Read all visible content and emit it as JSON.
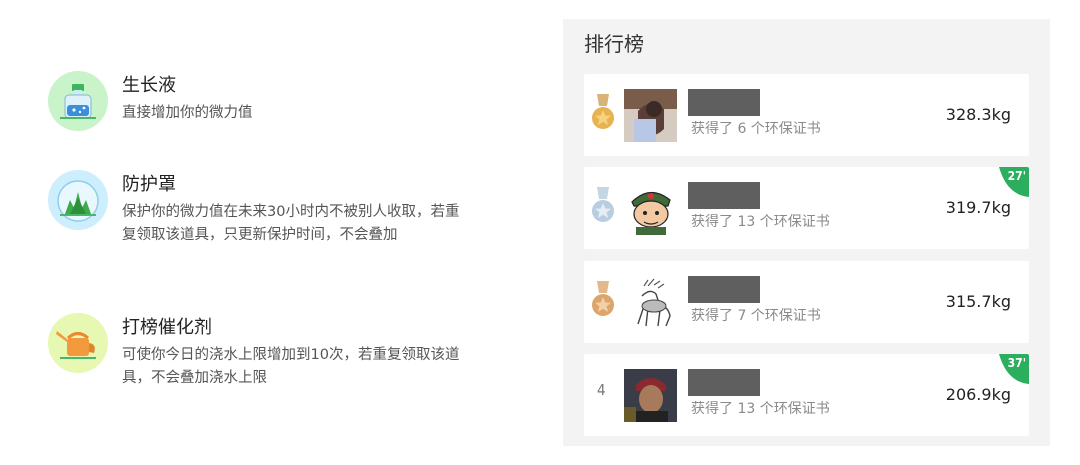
{
  "items": [
    {
      "title": "生长液",
      "desc": "直接增加你的微力值",
      "icon": "growth-liquid-bottle-icon",
      "color": "#c9f3c9"
    },
    {
      "title": "防护罩",
      "desc": "保护你的微力值在未来30小时内不被别人收取，若重复领取该道具，只更新保护时间，不会叠加",
      "icon": "protective-shield-icon",
      "color": "#cdeefc"
    },
    {
      "title": "打榜催化剂",
      "desc": "可使你今日的浇水上限增加到10次，若重复领取该道具，不会叠加浇水上限",
      "icon": "watering-can-icon",
      "color": "#e6f8b2"
    }
  ],
  "leaderboard": {
    "title": "排行榜",
    "rows": [
      {
        "rank_icon": "gold-medal-icon",
        "rank_text": "",
        "certs": "获得了 6 个环保证书",
        "weight": "328.3kg",
        "badge": ""
      },
      {
        "rank_icon": "silver-medal-icon",
        "rank_text": "",
        "certs": "获得了 13 个环保证书",
        "weight": "319.7kg",
        "badge": "27'"
      },
      {
        "rank_icon": "bronze-medal-icon",
        "rank_text": "",
        "certs": "获得了 7 个环保证书",
        "weight": "315.7kg",
        "badge": ""
      },
      {
        "rank_icon": "",
        "rank_text": "4",
        "certs": "获得了 13 个环保证书",
        "weight": "206.9kg",
        "badge": "37'"
      }
    ]
  },
  "colors": {
    "badge_green": "#2bae5e",
    "gold": "#e0a94a",
    "silver": "#aac4d6",
    "bronze": "#d6a066"
  }
}
